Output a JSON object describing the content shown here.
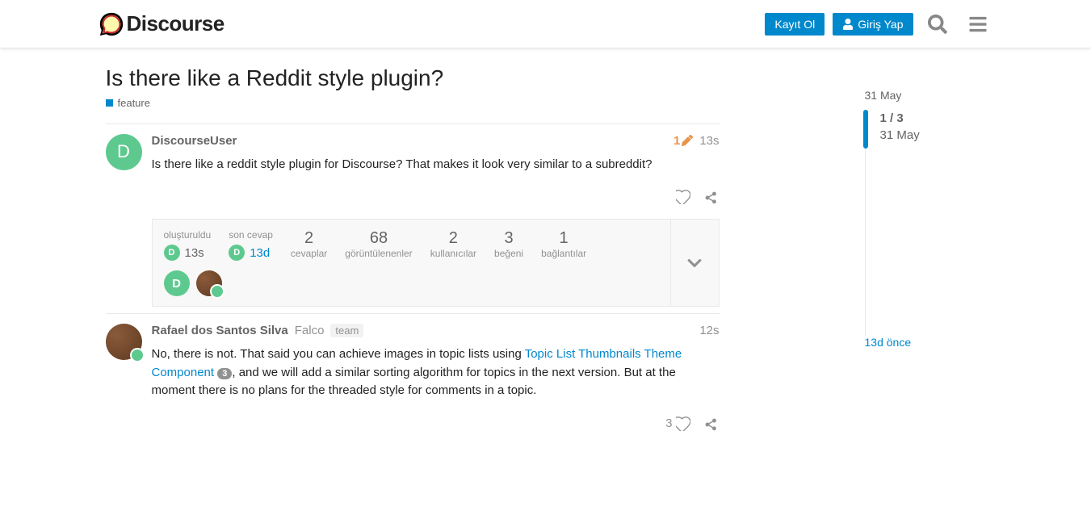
{
  "header": {
    "logo_text": "Discourse",
    "signup_label": "Kayıt Ol",
    "login_label": "Giriş Yap"
  },
  "topic": {
    "title": "Is there like a Reddit style plugin?",
    "category": "feature"
  },
  "posts": [
    {
      "username": "DiscourseUser",
      "avatar_letter": "D",
      "edits": "1",
      "date": "13s",
      "content": "Is there like a reddit style plugin for Discourse? That makes it look very similar to a subreddit?"
    },
    {
      "username": "Rafael dos Santos Silva",
      "nickname": "Falco",
      "team": "team",
      "date": "12s",
      "content_pre": "No, there is not. That said you can achieve images in topic lists using ",
      "link_text": "Topic List Thumbnails Theme Component",
      "link_count": "3",
      "content_post": ", and we will add a similar sorting algorithm for topics in the next version. But at the moment there is no plans for the threaded style for comments in a topic.",
      "likes": "3"
    }
  ],
  "topic_map": {
    "created_label": "oluşturuldu",
    "created_date": "13s",
    "last_reply_label": "son cevap",
    "last_reply_date": "13d",
    "stats": [
      {
        "num": "2",
        "label": "cevaplar"
      },
      {
        "num": "68",
        "label": "görüntülenenler"
      },
      {
        "num": "2",
        "label": "kullanıcılar"
      },
      {
        "num": "3",
        "label": "beğeni"
      },
      {
        "num": "1",
        "label": "bağlantılar"
      }
    ]
  },
  "timeline": {
    "top_date": "31 May",
    "position": "1 / 3",
    "pos_date": "31 May",
    "bottom": "13d önce"
  }
}
